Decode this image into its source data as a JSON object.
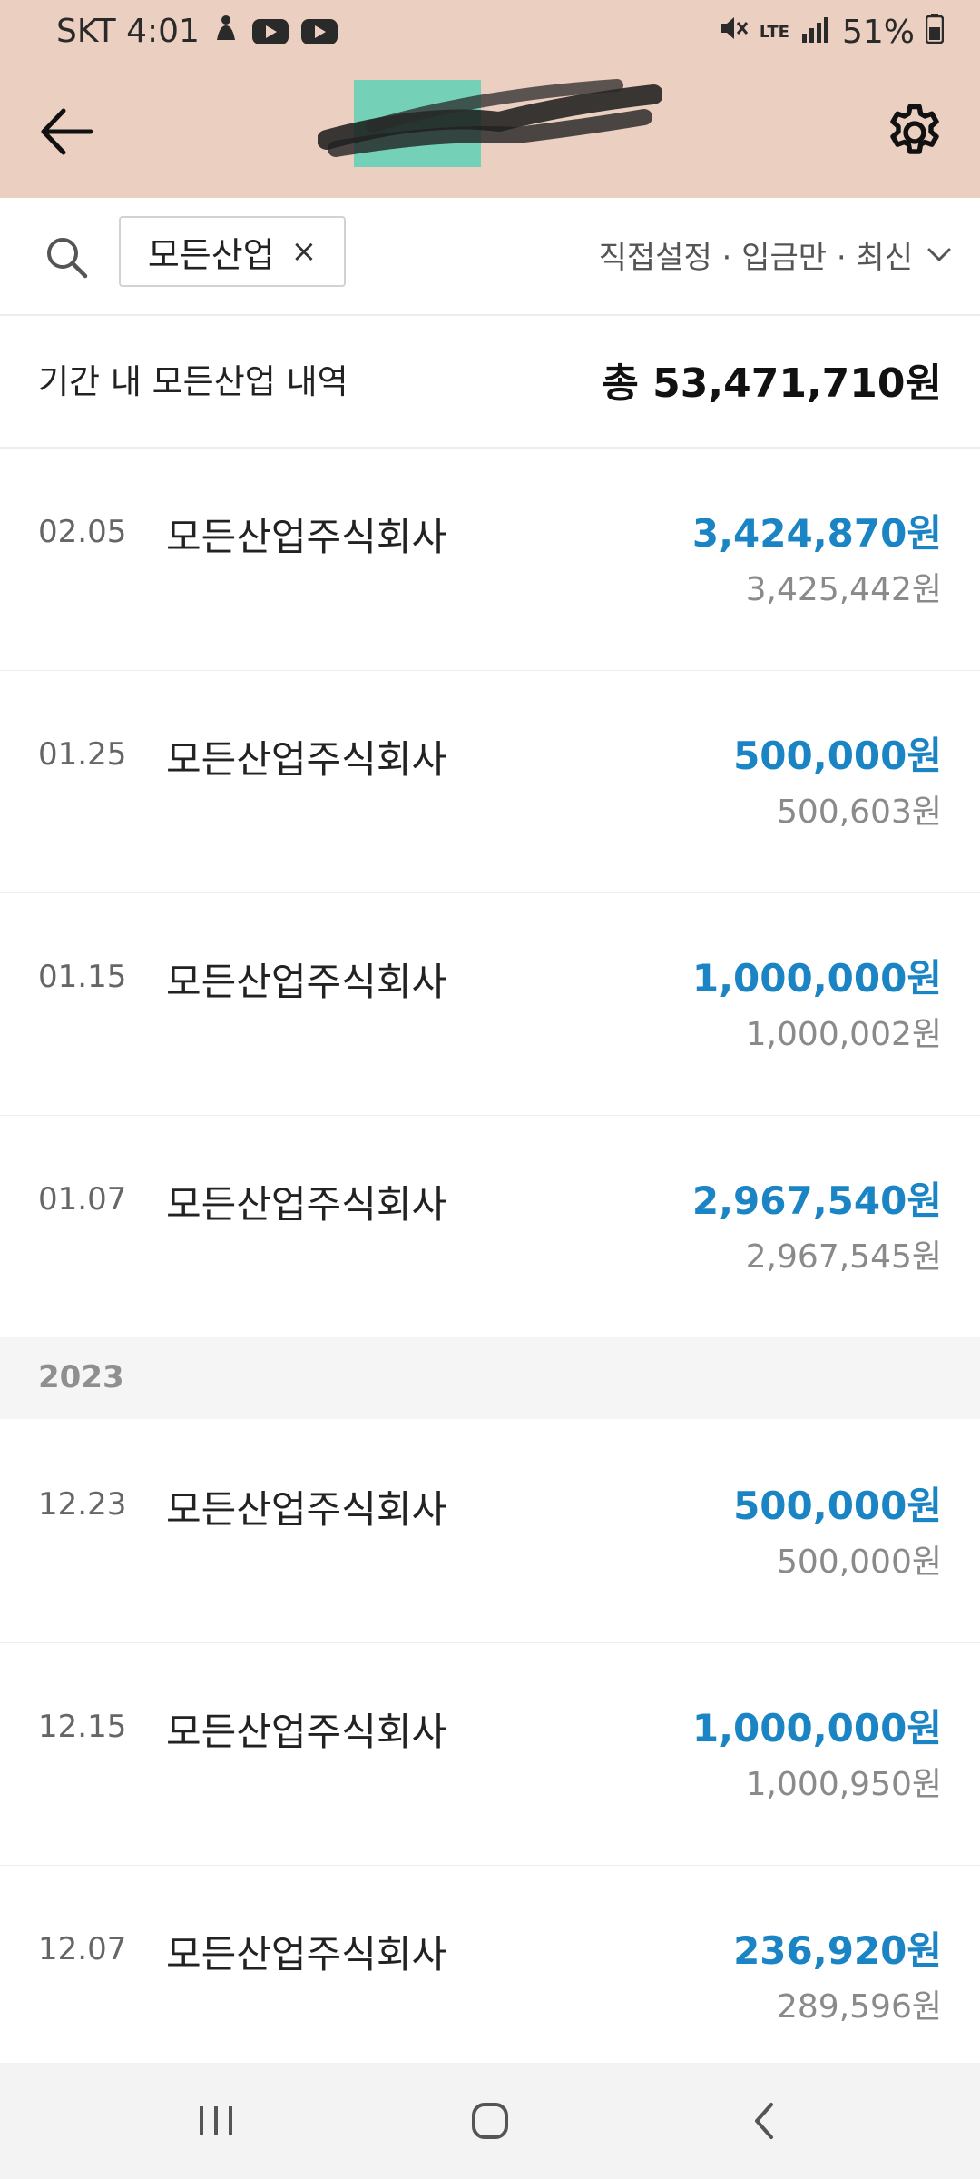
{
  "status_bar": {
    "carrier_time": "SKT 4:01",
    "network": "LTE",
    "battery": "51%"
  },
  "app_bar": {
    "title": "",
    "back_icon": "arrow-left-icon",
    "settings_icon": "gear-icon"
  },
  "filter_bar": {
    "chip_label": "모든산업",
    "chip_close": "×",
    "options_text": "직접설정 · 입금만 · 최신"
  },
  "summary": {
    "label": "기간 내 모든산업 내역",
    "total": "총 53,471,710원"
  },
  "transactions_2024": [
    {
      "date": "02.05",
      "name": "모든산업주식회사",
      "amount": "3,424,870원",
      "balance": "3,425,442원"
    },
    {
      "date": "01.25",
      "name": "모든산업주식회사",
      "amount": "500,000원",
      "balance": "500,603원"
    },
    {
      "date": "01.15",
      "name": "모든산업주식회사",
      "amount": "1,000,000원",
      "balance": "1,000,002원"
    },
    {
      "date": "01.07",
      "name": "모든산업주식회사",
      "amount": "2,967,540원",
      "balance": "2,967,545원"
    }
  ],
  "year_separator": "2023",
  "transactions_2023": [
    {
      "date": "12.23",
      "name": "모든산업주식회사",
      "amount": "500,000원",
      "balance": "500,000원"
    },
    {
      "date": "12.15",
      "name": "모든산업주식회사",
      "amount": "1,000,000원",
      "balance": "1,000,950원"
    },
    {
      "date": "12.07",
      "name": "모든산업주식회사",
      "amount": "236,920원",
      "balance": "289,596원"
    }
  ],
  "colors": {
    "header_bg": "#ebcfc1",
    "amount_blue": "#1a84c4",
    "balance_gray": "#8a8a8a"
  }
}
